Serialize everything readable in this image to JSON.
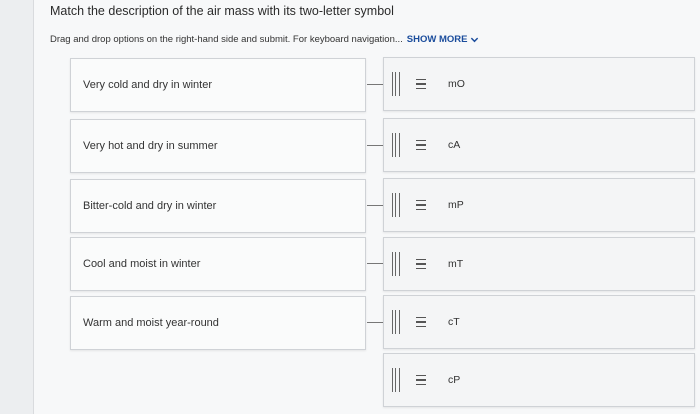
{
  "question": {
    "title": "Match the description of the air mass with its two-letter symbol",
    "instructions": "Drag and drop options on the right-hand side and submit. For keyboard navigation...",
    "show_more_label": "SHOW MORE"
  },
  "descriptions": [
    "Very cold and dry in winter",
    "Very hot and dry in summer",
    "Bitter-cold and dry in winter",
    "Cool and moist in winter",
    "Warm and moist year-round"
  ],
  "options": [
    "mO",
    "cA",
    "mP",
    "mT",
    "cT",
    "cP"
  ]
}
